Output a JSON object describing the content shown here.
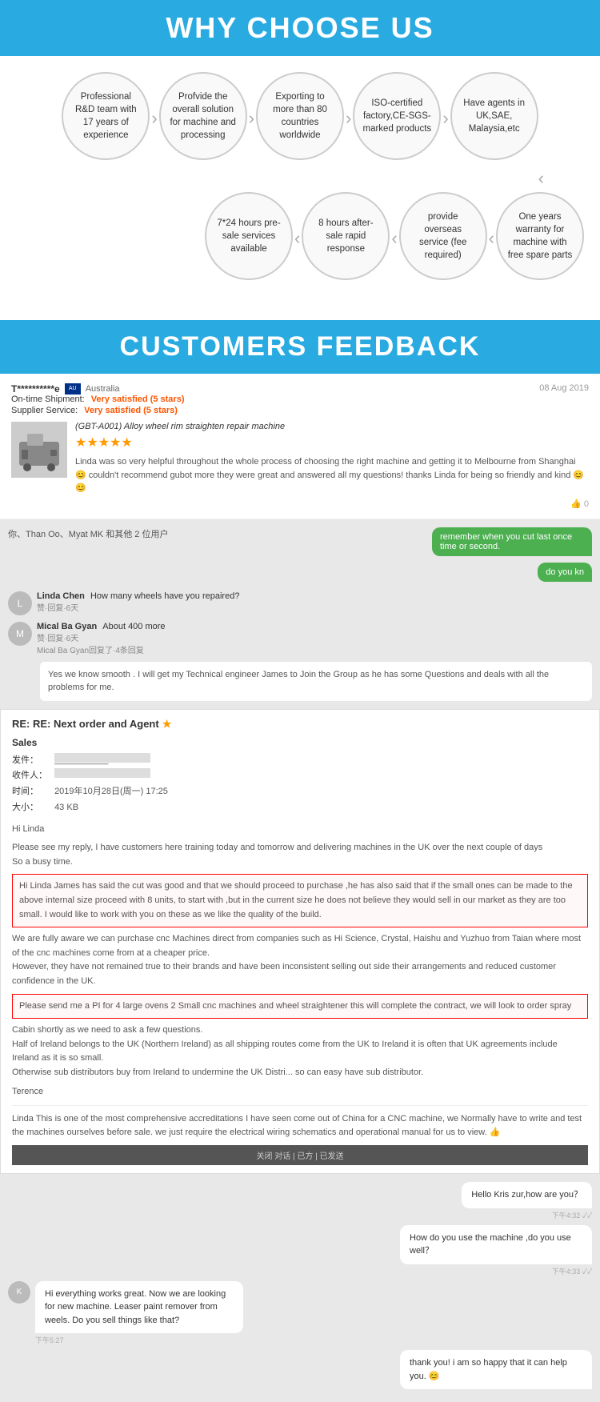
{
  "why_choose_us": {
    "title": "WHY CHOOSE US",
    "features_row1": [
      {
        "id": "f1",
        "text": "Professional R&D team with 17 years of experience"
      },
      {
        "id": "f2",
        "text": "Profvide the overall solution for machine and processing"
      },
      {
        "id": "f3",
        "text": "Exporting to more than 80 countries worldwide"
      },
      {
        "id": "f4",
        "text": "ISO-certified factory,CE-SGS-marked products"
      },
      {
        "id": "f5",
        "text": "Have agents in UK,SAE, Malaysia,etc"
      }
    ],
    "features_row2": [
      {
        "id": "f6",
        "text": "7*24 hours pre-sale services available"
      },
      {
        "id": "f7",
        "text": "8 hours after-sale rapid response"
      },
      {
        "id": "f8",
        "text": "provide overseas service (fee required)"
      },
      {
        "id": "f9",
        "text": "One years warranty for machine with free spare parts"
      }
    ]
  },
  "customers_feedback": {
    "title": "CUSTOMERS FEEDBACK",
    "review": {
      "username": "T**********e",
      "country": "Australia",
      "date": "08 Aug 2019",
      "on_time_shipment": "Very satisfied  (5 stars)",
      "supplier_service": "Very satisfied  (5 stars)",
      "product_title": "(GBT-A001) Alloy wheel rim straighten repair machine",
      "stars": "★★★★★",
      "review_text": "Linda was so very helpful throughout the whole process of choosing the right machine and getting it to Melbourne from Shanghai 😊 couldn't recommend gubot more they were great and answered all my questions! thanks Linda for being so friendly and kind 😊😊",
      "likes": "0"
    },
    "chat1": {
      "group_label": "你、Than Oo、Myat MK 和其他 2 位用户",
      "bubble1": "remember when you cut last once time or second.",
      "bubble2": "do you kn",
      "sender1": "Linda Chen",
      "sender1_sub": "赞·回复·6天",
      "message1": "How many wheels have you repaired?",
      "sender2": "Mical Ba Gyan",
      "sender2_sub": "赞·回复·6天",
      "message2": "About 400 more",
      "sender2b_sub": "赞·回复·4条回复",
      "sender2b": "Mical Ba Gyan回复了·4条回复",
      "reply_text": "Yes we know smooth . I will get my Technical engineer James to Join the Group as he has some Questions and deals with all the problems for me."
    },
    "email": {
      "subject": "RE: RE: Next order and Agent",
      "from_label": "发件人：",
      "from_value": "___________",
      "to_label": "收件人：",
      "to_value": "___________",
      "date_label": "时间：",
      "date_value": "2019年10月28日(周一) 17:25",
      "size_label": "大小：",
      "size_value": "43 KB",
      "greeting": "Hi Linda",
      "body1": "Please see my reply, I have customers here training today and tomorrow and delivering machines in the UK over the next couple of days\nSo a busy time.",
      "highlight1": "Hi Linda James has said the cut was good and that we should proceed to purchase ,he has also said that if the small ones can be made to the above internal size proceed with 8 units, to start with ,but in the current size he does not believe they would sell in our market as they are too small. I would like to work with you on these as we like the quality of the build.",
      "body2": "We are fully aware we can purchase cnc Machines direct from companies such as Hi Science, Crystal, Haishu and Yuzhuo from Taian where most of the cnc machines come from at a cheaper price.\nHowever, they have not remained true to their brands and have been inconsistent selling out side their arrangements and reduced customer confidence in the UK.",
      "highlight2": "Please send me a PI for 4 large ovens 2 Small cnc machines and wheel straightener this will complete the contract, we will look to order spray",
      "body3": "Cabin shortly as we need to ask a few questions.\nHalf of Ireland belongs to the UK (Northern Ireland) as all shipping routes come from the UK to Ireland it is often that UK agreements include\nIreland as it is so small.\nOtherwise sub distributors buy from Ireland to undermine the UK Distri... so can easy have sub distributor.",
      "sign": "Terence",
      "testimonial": "Linda This is one of the most comprehensive accreditations I have seen come out of China for a CNC machine, we Normally have to write and test the machines ourselves before sale. we just require the electrical wiring schematics and operational manual for us to view. 👍"
    },
    "bottom_chat": {
      "msg1": "Hello Kris zur,how are you？",
      "msg1_time": "下午4:32 ✓✓",
      "msg2": "How do you use the machine ,do you use well？",
      "msg2_time": "下午4:33 ✓✓",
      "reply_text": "Hi everything works great. Now we are looking for new machine. Leaser paint remover from weels. Do you sell things like that?",
      "reply_time": "下午5:27",
      "final_msg": "thank you! i am so happy that it can help you. 😊",
      "bottom_bar": "关闭对话 | 已方 | 已发送"
    }
  }
}
